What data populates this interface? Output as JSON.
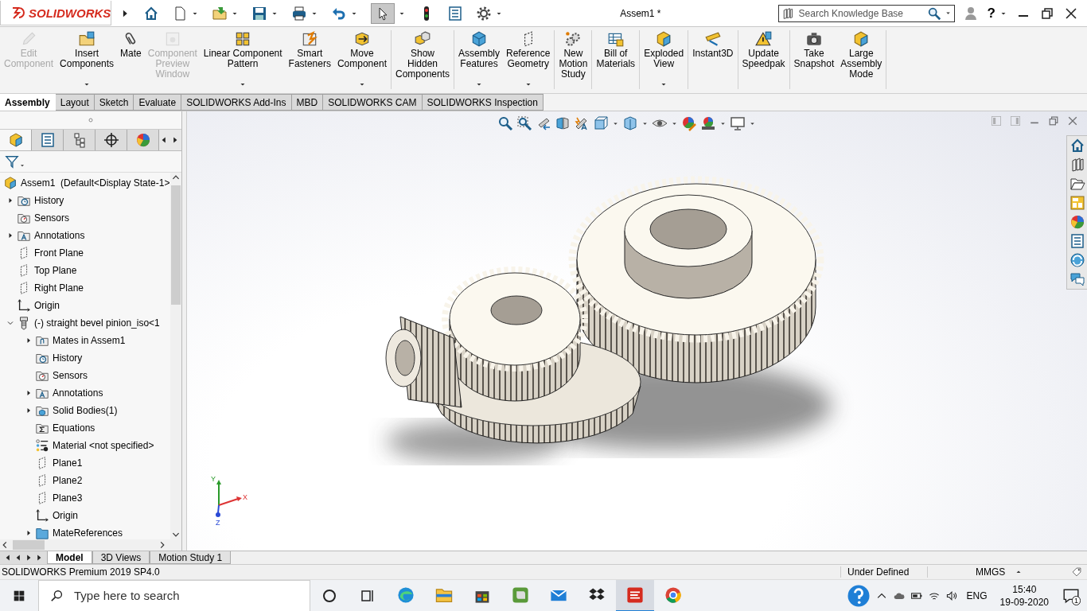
{
  "window": {
    "title": "Assem1 *"
  },
  "logo": {
    "text": "SOLIDWORKS"
  },
  "search": {
    "placeholder": "Search Knowledge Base"
  },
  "help": {
    "label": "?"
  },
  "command_groups": [
    {
      "commands": [
        {
          "label_lines": [
            "Edit",
            "Component"
          ],
          "kind": "pencil",
          "disabled": true,
          "dropdown": false
        },
        {
          "label_lines": [
            "Insert",
            "Components"
          ],
          "kind": "insert",
          "disabled": false,
          "dropdown": true
        },
        {
          "label_lines": [
            "Mate"
          ],
          "kind": "paperclip",
          "disabled": false,
          "dropdown": false
        },
        {
          "label_lines": [
            "Component",
            "Preview",
            "Window"
          ],
          "kind": "window",
          "disabled": true,
          "dropdown": false
        },
        {
          "label_lines": [
            "Linear Component",
            "Pattern"
          ],
          "kind": "grid",
          "disabled": false,
          "dropdown": true
        },
        {
          "label_lines": [
            "Smart",
            "Fasteners"
          ],
          "kind": "screw",
          "disabled": false,
          "dropdown": false
        },
        {
          "label_lines": [
            "Move",
            "Component"
          ],
          "kind": "move",
          "disabled": false,
          "dropdown": true
        }
      ]
    },
    {
      "commands": [
        {
          "label_lines": [
            "Show",
            "Hidden",
            "Components"
          ],
          "kind": "cubes",
          "disabled": false,
          "dropdown": false
        }
      ]
    },
    {
      "commands": [
        {
          "label_lines": [
            "Assembly",
            "Features"
          ],
          "kind": "bluecube",
          "disabled": false,
          "dropdown": true
        },
        {
          "label_lines": [
            "Reference",
            "Geometry"
          ],
          "kind": "plane",
          "disabled": false,
          "dropdown": true
        }
      ]
    },
    {
      "commands": [
        {
          "label_lines": [
            "New",
            "Motion",
            "Study"
          ],
          "kind": "gears",
          "disabled": false,
          "dropdown": false
        }
      ]
    },
    {
      "commands": [
        {
          "label_lines": [
            "Bill of",
            "Materials"
          ],
          "kind": "table",
          "disabled": false,
          "dropdown": false
        }
      ]
    },
    {
      "commands": [
        {
          "label_lines": [
            "Exploded",
            "View"
          ],
          "kind": "yellowcube",
          "disabled": false,
          "dropdown": true
        }
      ]
    },
    {
      "commands": [
        {
          "label_lines": [
            "Instant3D"
          ],
          "kind": "ruler",
          "disabled": false,
          "dropdown": false
        }
      ]
    },
    {
      "commands": [
        {
          "label_lines": [
            "Update",
            "Speedpak"
          ],
          "kind": "warning",
          "disabled": false,
          "dropdown": false
        }
      ]
    },
    {
      "commands": [
        {
          "label_lines": [
            "Take",
            "Snapshot"
          ],
          "kind": "camera",
          "disabled": false,
          "dropdown": false
        },
        {
          "label_lines": [
            "Large",
            "Assembly",
            "Mode"
          ],
          "kind": "yellowcube",
          "disabled": false,
          "dropdown": false
        }
      ]
    }
  ],
  "tabs": [
    {
      "label": "Assembly",
      "selected": true
    },
    {
      "label": "Layout",
      "selected": false
    },
    {
      "label": "Sketch",
      "selected": false
    },
    {
      "label": "Evaluate",
      "selected": false
    },
    {
      "label": "SOLIDWORKS Add-Ins",
      "selected": false
    },
    {
      "label": "MBD",
      "selected": false
    },
    {
      "label": "SOLIDWORKS CAM",
      "selected": false
    },
    {
      "label": "SOLIDWORKS Inspection",
      "selected": false
    }
  ],
  "feature_tabs": [
    {
      "kind": "yellowcube",
      "selected": true
    },
    {
      "kind": "list",
      "selected": false
    },
    {
      "kind": "config",
      "selected": false
    },
    {
      "kind": "crosshair",
      "selected": false
    },
    {
      "kind": "ball",
      "selected": false
    }
  ],
  "tree": {
    "label": "Assem1  (Default<Display State-1>",
    "kind": "assembly",
    "children": [
      {
        "label": "History",
        "kind": "history",
        "expanded": false
      },
      {
        "label": "Sensors",
        "kind": "sensors"
      },
      {
        "label": "Annotations",
        "kind": "annotations",
        "expanded": false
      },
      {
        "label": "Front Plane",
        "kind": "plane"
      },
      {
        "label": "Top Plane",
        "kind": "plane"
      },
      {
        "label": "Right Plane",
        "kind": "plane"
      },
      {
        "label": "Origin",
        "kind": "origin"
      },
      {
        "label": "(-) straight bevel pinion_iso<1",
        "kind": "part",
        "expanded": true,
        "children": [
          {
            "label": "Mates in Assem1",
            "kind": "mates",
            "expanded": false
          },
          {
            "label": "History",
            "kind": "history"
          },
          {
            "label": "Sensors",
            "kind": "sensors"
          },
          {
            "label": "Annotations",
            "kind": "annotations",
            "expanded": false
          },
          {
            "label": "Solid Bodies(1)",
            "kind": "bodies",
            "expanded": false
          },
          {
            "label": "Equations",
            "kind": "equations"
          },
          {
            "label": "Material <not specified>",
            "kind": "material"
          },
          {
            "label": "Plane1",
            "kind": "plane"
          },
          {
            "label": "Plane2",
            "kind": "plane"
          },
          {
            "label": "Plane3",
            "kind": "plane"
          },
          {
            "label": "Origin",
            "kind": "origin"
          },
          {
            "label": "MateReferences",
            "kind": "folder",
            "expanded": false
          }
        ]
      }
    ]
  },
  "triad": {
    "x": "X",
    "y": "Y",
    "z": "Z"
  },
  "bottom_tabs": [
    {
      "label": "Model",
      "selected": true
    },
    {
      "label": "3D Views",
      "selected": false
    },
    {
      "label": "Motion Study 1",
      "selected": false
    }
  ],
  "status_bar": {
    "product": "SOLIDWORKS Premium 2019 SP4.0",
    "state": "Under Defined",
    "units": "MMGS"
  },
  "taskbar": {
    "search_placeholder": "Type here to search",
    "apps": [
      {
        "kind": "edge",
        "active": false
      },
      {
        "kind": "explorer",
        "active": false
      },
      {
        "kind": "store",
        "active": false
      },
      {
        "kind": "evernote",
        "active": false
      },
      {
        "kind": "mail",
        "active": false
      },
      {
        "kind": "dropbox",
        "active": false
      },
      {
        "kind": "sw",
        "active": true
      },
      {
        "kind": "chrome",
        "active": false
      }
    ],
    "language": "ENG",
    "time": "15:40",
    "date": "19-09-2020",
    "notifications": "1"
  }
}
